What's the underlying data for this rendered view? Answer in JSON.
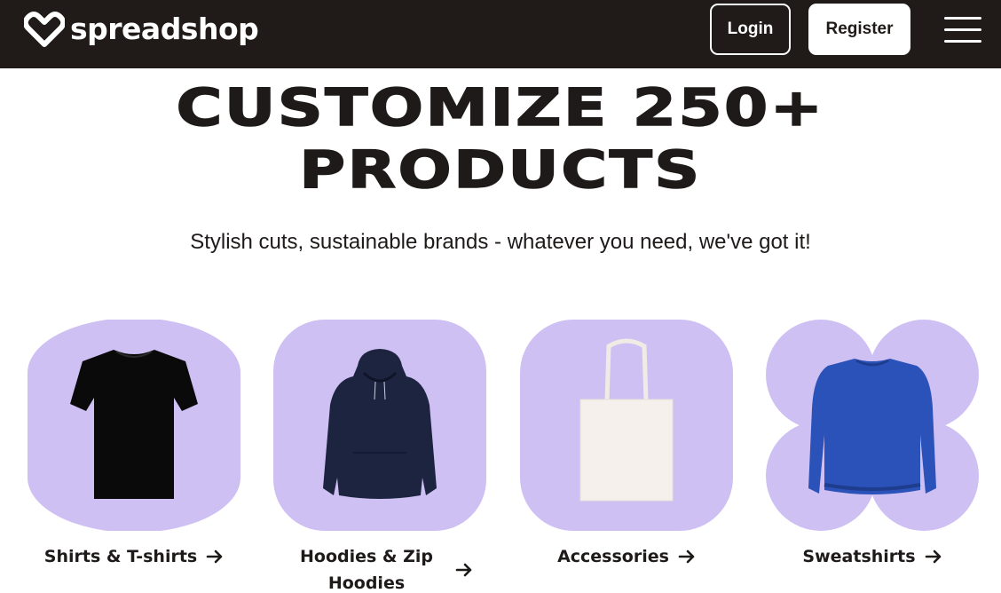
{
  "header": {
    "logo_text": "spreadshop",
    "login_label": "Login",
    "register_label": "Register",
    "menu_icon": "hamburger-menu-icon",
    "logo_icon": "heart-outline-logo-icon"
  },
  "hero": {
    "title": "CUSTOMIZE 250+ PRODUCTS",
    "title_line1": "CUSTOMIZE 250+",
    "title_line2": "PRODUCTS",
    "subtitle": "Stylish cuts, sustainable brands - whatever you need, we've got it!"
  },
  "categories": [
    {
      "label": "Shirts & T-shirts",
      "icon": "arrow-right-icon",
      "image": "black-tshirt"
    },
    {
      "label": "Hoodies & Zip Hoodies",
      "icon": "arrow-right-icon",
      "image": "navy-hoodie"
    },
    {
      "label": "Accessories",
      "icon": "arrow-right-icon",
      "image": "white-tote-bag"
    },
    {
      "label": "Sweatshirts",
      "icon": "arrow-right-icon",
      "image": "blue-sweatshirt"
    }
  ],
  "colors": {
    "header_bg": "#201a18",
    "tile_bg": "#cfc0f4",
    "text": "#1e1a19"
  }
}
